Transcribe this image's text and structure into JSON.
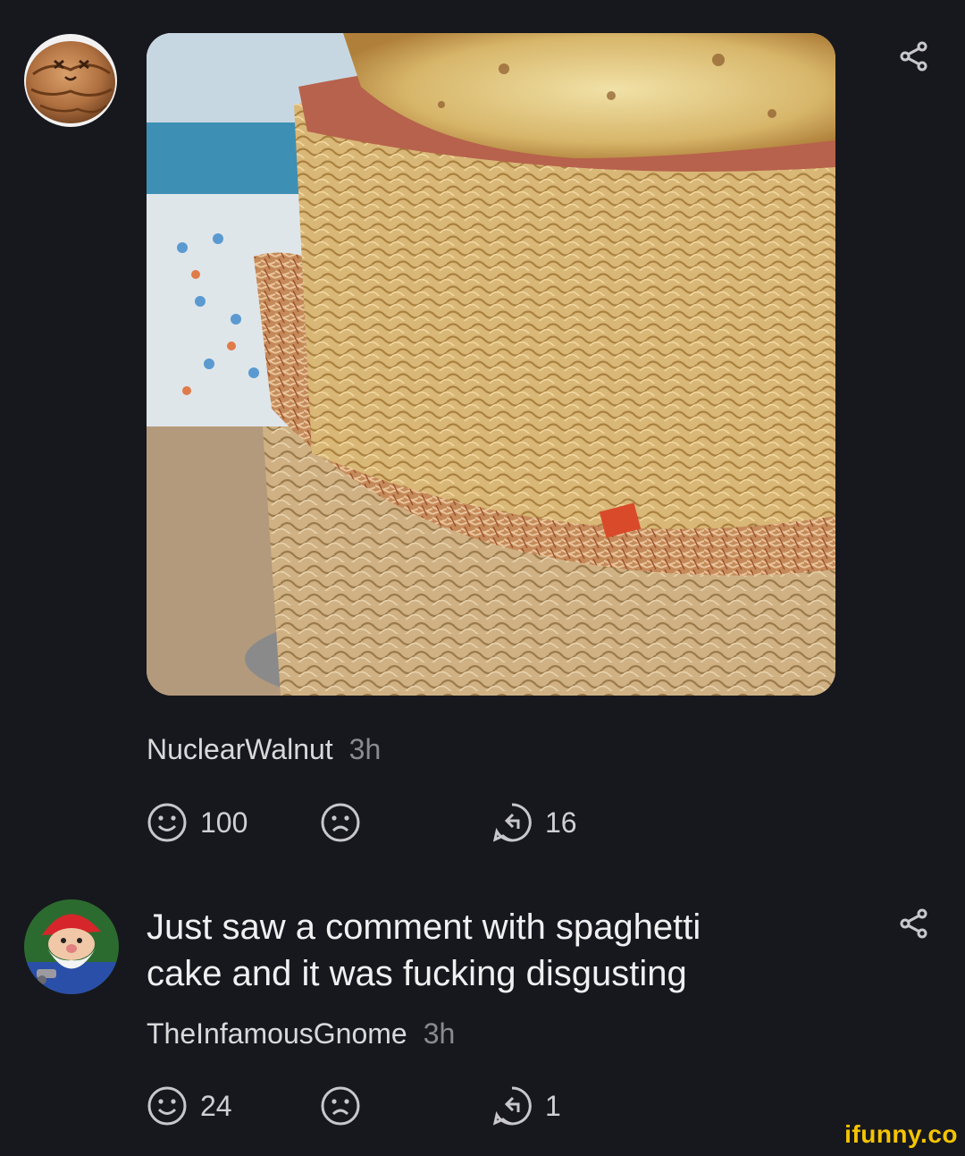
{
  "post": {
    "username": "NuclearWalnut",
    "time": "3h",
    "smile_count": "100",
    "reply_count": "16"
  },
  "comment": {
    "text_line1": "Just saw a comment with spaghetti",
    "text_line2": "cake and it was fucking disgusting",
    "username": "TheInfamousGnome",
    "time": "3h",
    "smile_count": "24",
    "reply_count": "1"
  },
  "watermark": "ifunny.co",
  "colors": {
    "background": "#17181d",
    "text": "#e8e8ea",
    "muted": "#8a8a90",
    "watermark": "#f5c400"
  },
  "icons": [
    "share-icon",
    "smile-icon",
    "frown-icon",
    "reply-icon"
  ]
}
